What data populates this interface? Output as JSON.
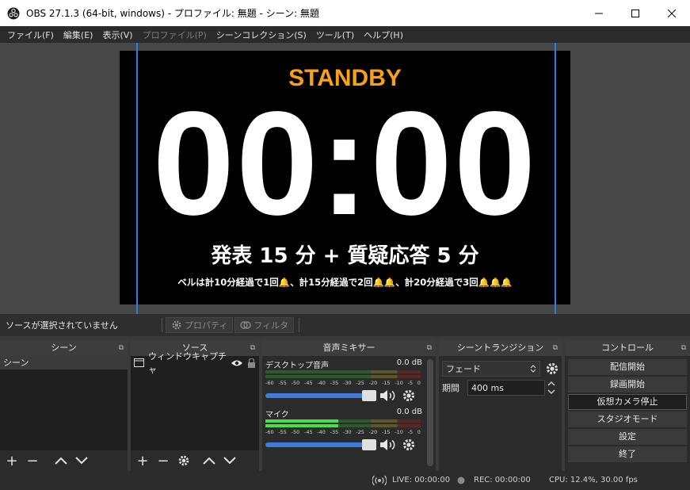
{
  "window": {
    "title": "OBS 27.1.3 (64-bit, windows) - プロファイル: 無題 - シーン: 無題"
  },
  "menu": [
    "ファイル(F)",
    "編集(E)",
    "表示(V)",
    "プロファイル(P)",
    "シーンコレクション(S)",
    "ツール(T)",
    "ヘルプ(H)"
  ],
  "menu_disabled_index": 3,
  "preview": {
    "standby": "STANDBY",
    "timer": "00:00",
    "subtitle": "発表 15 分 + 質疑応答 5 分",
    "note": "ベルは計10分経過で1回🔔、計15分経過で2回🔔🔔、計20分経過で3回🔔🔔🔔",
    "standby_color": "#f7a11a",
    "guide_color": "#2a7de1"
  },
  "source_toolbar": {
    "no_source": "ソースが選択されていません",
    "properties": "プロパティ",
    "filters": "フィルタ"
  },
  "scenes": {
    "title": "シーン",
    "items": [
      "シーン"
    ]
  },
  "sources": {
    "title": "ソース",
    "items": [
      {
        "label": "ウィンドウキャプチャ",
        "icon": "window-icon"
      }
    ]
  },
  "mixer": {
    "title": "音声ミキサー",
    "ticks": [
      "-60",
      "-55",
      "-50",
      "-45",
      "-40",
      "-35",
      "-30",
      "-25",
      "-20",
      "-15",
      "-10",
      "-5",
      "0"
    ],
    "channels": [
      {
        "name": "デスクトップ音声",
        "db": "0.0 dB",
        "level": 0.0,
        "volume": 1.0
      },
      {
        "name": "マイク",
        "db": "0.0 dB",
        "level": 0.47,
        "volume": 1.0
      }
    ]
  },
  "transitions": {
    "title": "シーントランジション",
    "selected": "フェード",
    "duration_label": "期間",
    "duration_value": "400 ms"
  },
  "controls": {
    "title": "コントロール",
    "buttons": [
      "配信開始",
      "録画開始",
      "仮想カメラ停止",
      "スタジオモード",
      "設定",
      "終了"
    ],
    "active_index": 2
  },
  "status": {
    "live": "LIVE: 00:00:00",
    "rec": "REC: 00:00:00",
    "cpu": "CPU: 12.4%, 30.00 fps"
  }
}
